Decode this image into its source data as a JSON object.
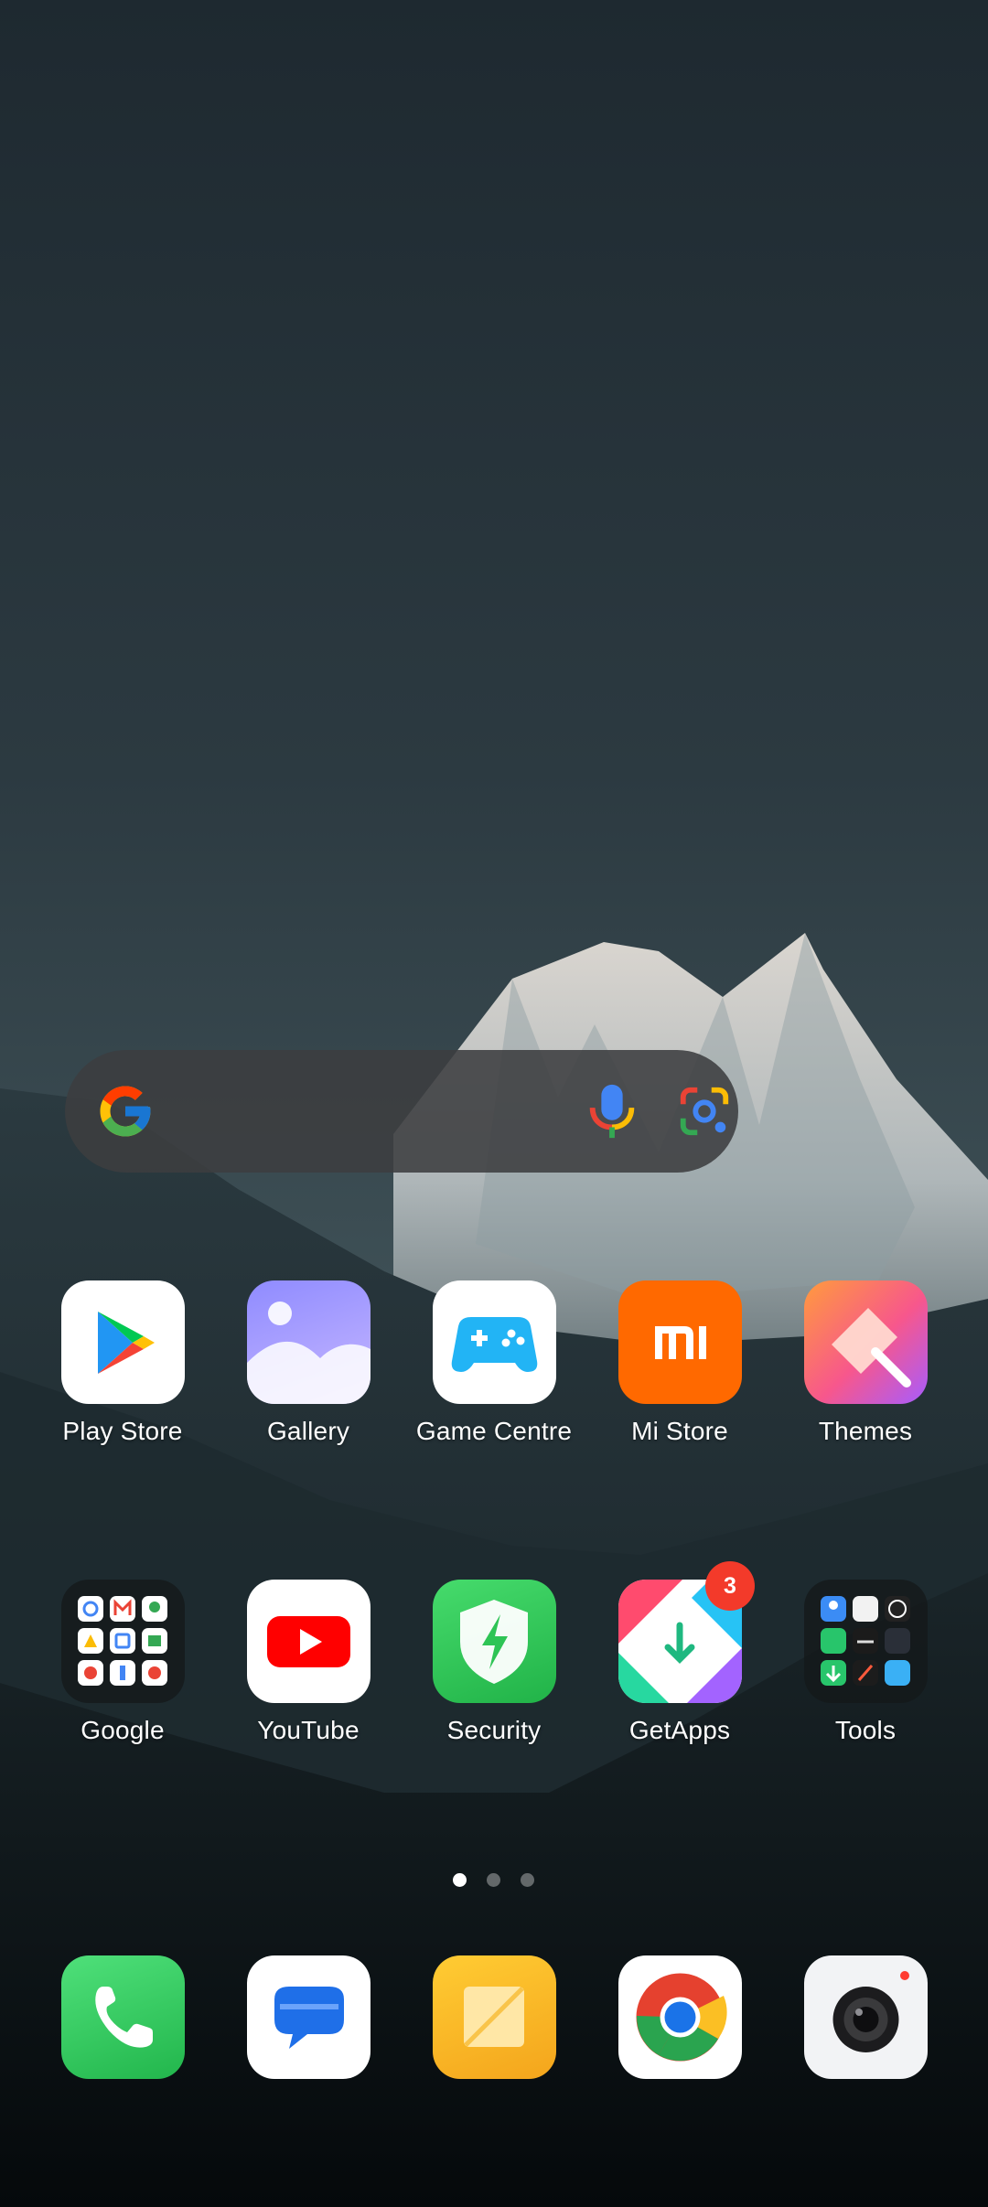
{
  "search_widget": {
    "google_logo_icon": "google-g-icon",
    "voice_icon": "mic-icon",
    "lens_icon": "google-lens-icon"
  },
  "home_grid": {
    "row1": [
      {
        "label": "Play Store",
        "icon": "play-store-icon"
      },
      {
        "label": "Gallery",
        "icon": "gallery-icon"
      },
      {
        "label": "Game Centre",
        "icon": "gamepad-icon"
      },
      {
        "label": "Mi Store",
        "icon": "mi-logo-icon"
      },
      {
        "label": "Themes",
        "icon": "paintbrush-icon"
      }
    ],
    "row2": [
      {
        "label": "Google",
        "icon": "google-folder-icon"
      },
      {
        "label": "YouTube",
        "icon": "youtube-icon"
      },
      {
        "label": "Security",
        "icon": "shield-bolt-icon"
      },
      {
        "label": "GetApps",
        "icon": "getapps-icon",
        "badge": "3"
      },
      {
        "label": "Tools",
        "icon": "tools-folder-icon"
      }
    ]
  },
  "page_indicator": {
    "total": 3,
    "current": 1
  },
  "dock": [
    {
      "icon": "phone-icon"
    },
    {
      "icon": "messages-icon"
    },
    {
      "icon": "notes-icon"
    },
    {
      "icon": "chrome-icon"
    },
    {
      "icon": "camera-icon"
    }
  ],
  "colors": {
    "badge": "#f33a2a",
    "mi_orange": "#ff6900",
    "security_green": "#34c759",
    "phone_green": "#2ecc5c"
  }
}
